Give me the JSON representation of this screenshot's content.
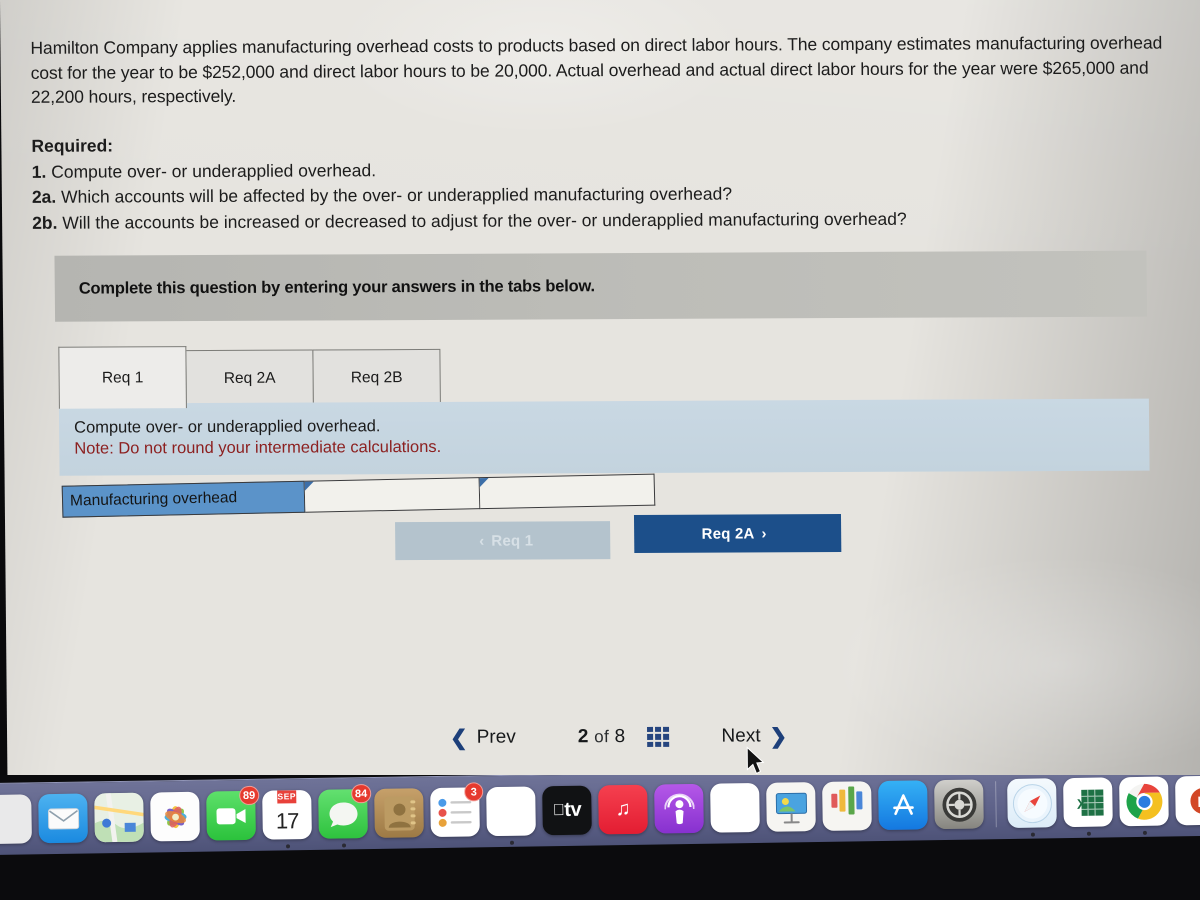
{
  "problem": {
    "statement": "Hamilton Company applies manufacturing overhead costs to products based on direct labor hours. The company estimates manufacturing overhead cost for the year to be $252,000 and direct labor hours to be 20,000. Actual overhead and actual direct labor hours for the year were $265,000 and 22,200 hours, respectively.",
    "required_heading": "Required:",
    "items": [
      {
        "label": "1.",
        "text": "Compute over- or underapplied overhead."
      },
      {
        "label": "2a.",
        "text": "Which accounts will be affected by the over- or underapplied manufacturing overhead?"
      },
      {
        "label": "2b.",
        "text": "Will the accounts be increased or decreased to adjust for the over- or underapplied manufacturing overhead?"
      }
    ]
  },
  "banner": {
    "text": "Complete this question by entering your answers in the tabs below."
  },
  "tabs": [
    {
      "label": "Req 1",
      "active": true
    },
    {
      "label": "Req 2A",
      "active": false
    },
    {
      "label": "Req 2B",
      "active": false
    }
  ],
  "panel": {
    "instruction": "Compute over- or underapplied overhead.",
    "note": "Note: Do not round your intermediate calculations."
  },
  "answer_table": {
    "row_label": "Manufacturing overhead",
    "cells": [
      "",
      ""
    ]
  },
  "req_nav": {
    "prev_label": "Req 1",
    "prev_chevron": "‹",
    "next_label": "Req 2A",
    "next_chevron": "›",
    "prev_disabled": true
  },
  "pagination": {
    "prev_label": "Prev",
    "prev_chevron": "❮",
    "current": "2",
    "of_word": "of",
    "total": "8",
    "grid_icon": "grid-icon",
    "next_label": "Next",
    "next_chevron": "❯"
  },
  "colors": {
    "accent_blue": "#1c4f8a",
    "panel_blue": "#c3d3de",
    "label_blue": "#5b93c9",
    "note_red": "#8c2020",
    "banner_gray": "#bdbdb8",
    "page_bg": "#e6e4df",
    "dock_bg": "#5d6188"
  },
  "dock": {
    "left_items": [
      {
        "name": "launchpad",
        "label": "Launchpad",
        "badge": null,
        "running": false
      },
      {
        "name": "mail",
        "label": "Mail",
        "badge": null,
        "running": false
      },
      {
        "name": "maps",
        "label": "Maps",
        "badge": null,
        "running": false
      },
      {
        "name": "photos",
        "label": "Photos",
        "badge": null,
        "running": false
      },
      {
        "name": "facetime",
        "label": "FaceTime",
        "badge": "89",
        "running": false
      },
      {
        "name": "calendar",
        "label": "Calendar",
        "badge": null,
        "running": true,
        "month": "SEP",
        "day": "17"
      },
      {
        "name": "messages",
        "label": "Messages",
        "badge": "84",
        "running": true
      },
      {
        "name": "contacts",
        "label": "Contacts",
        "badge": null,
        "running": false
      },
      {
        "name": "reminders",
        "label": "Reminders",
        "badge": "3",
        "running": false
      },
      {
        "name": "notes",
        "label": "Notes",
        "badge": null,
        "running": true
      },
      {
        "name": "tv",
        "label": "TV",
        "badge": null,
        "running": false
      },
      {
        "name": "music",
        "label": "Music",
        "badge": null,
        "running": false
      },
      {
        "name": "podcasts",
        "label": "Podcasts",
        "badge": null,
        "running": false
      },
      {
        "name": "news",
        "label": "News",
        "badge": null,
        "running": false
      },
      {
        "name": "keynote",
        "label": "Keynote",
        "badge": null,
        "running": false
      },
      {
        "name": "numbers",
        "label": "Numbers",
        "badge": null,
        "running": false
      },
      {
        "name": "appstore",
        "label": "App Store",
        "badge": null,
        "running": false
      },
      {
        "name": "settings",
        "label": "System Settings",
        "badge": null,
        "running": false
      }
    ],
    "right_items": [
      {
        "name": "safari",
        "label": "Safari",
        "badge": null,
        "running": true
      },
      {
        "name": "excel",
        "label": "Excel",
        "badge": null,
        "running": true
      },
      {
        "name": "chrome",
        "label": "Chrome",
        "badge": null,
        "running": true
      },
      {
        "name": "powerpoint",
        "label": "PowerPoint",
        "badge": null,
        "running": false
      }
    ],
    "tv_label": "tv"
  }
}
